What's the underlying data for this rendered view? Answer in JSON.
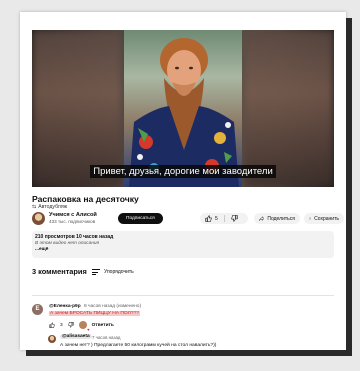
{
  "video": {
    "subtitle": "Привет, друзья, дорогие мои заводители"
  },
  "title": "Распаковка на десяточку",
  "fragment_label": "Автодубляж",
  "channel": {
    "name": "Учимся с Алисой",
    "subscribers": "433 тыс. подписчиков",
    "subscribe_label": "Подписаться"
  },
  "actions": {
    "likes": "5",
    "share_label": "Поделиться",
    "save_label": "Сохранить"
  },
  "description": {
    "stats": "210 просмотров  10 часов назад",
    "empty_text": "В этом видео нет описания",
    "more_label": "...ещё"
  },
  "comments": {
    "count_label": "3 комментария",
    "sort_label": "Упорядочить",
    "items": [
      {
        "avatar_letter": "Е",
        "author": "@Еленка-p9p",
        "time": "8 часов назад (изменено)",
        "text": "А зачем БРОСАТЬ ПИЦЦУ НА ПОЛ???",
        "likes": "3",
        "reply_label": "Ответить",
        "reply": {
          "author": "@alisasaeta",
          "time": "7 часов назад",
          "text": "А зачем нет? ) Предлагаете 50 килограмм кучей на стол навалить?))"
        }
      }
    ]
  },
  "colors": {
    "highlight_bg": "#f6c9c9",
    "highlight_text": "#d61f1f",
    "subscribe_bg": "#0f0f0f"
  }
}
